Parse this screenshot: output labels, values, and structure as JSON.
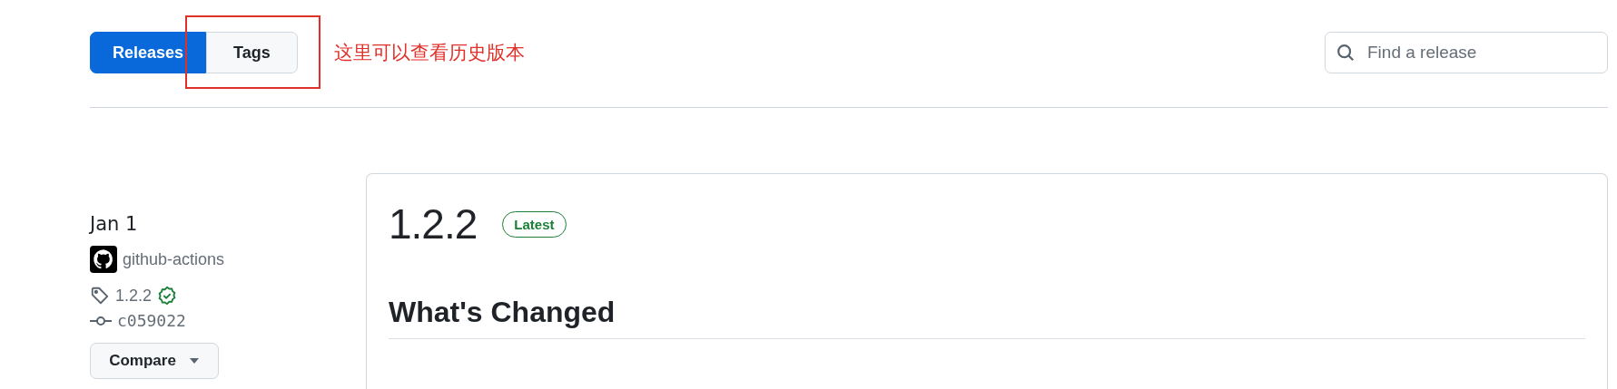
{
  "tabs": [
    {
      "label": "Releases",
      "selected": true,
      "annotated": false
    },
    {
      "label": "Tags",
      "selected": false,
      "annotated": true
    }
  ],
  "annotation": {
    "text": "这里可以查看历史版本"
  },
  "search": {
    "placeholder": "Find a release"
  },
  "release": {
    "date": "Jan 1",
    "author": "github-actions",
    "tag": "1.2.2",
    "tag_verified": true,
    "commit": "c059022",
    "compare_label": "Compare",
    "title": "1.2.2",
    "badge": "Latest",
    "heading": "What's Changed"
  }
}
